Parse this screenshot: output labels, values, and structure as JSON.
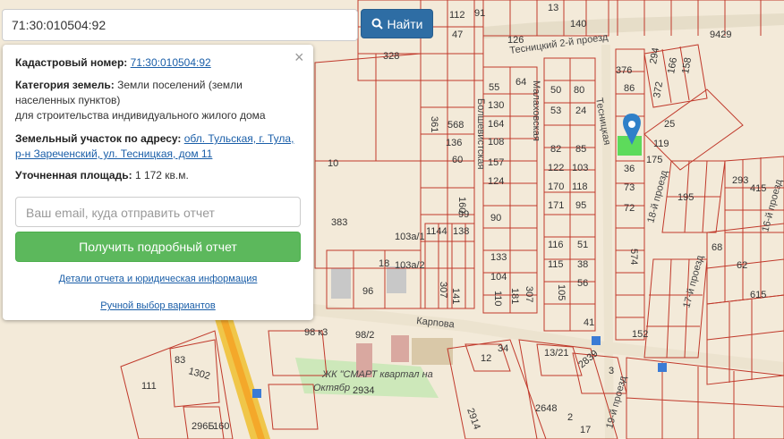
{
  "search": {
    "value": "71:30:010504:92",
    "button_label": "Найти"
  },
  "popup": {
    "cadastral_label": "Кадастровый номер:",
    "cadastral_value": "71:30:010504:92",
    "category_label": "Категория земель:",
    "category_value_1": "Земли поселений (земли",
    "category_value_2": "населенных пунктов)",
    "category_value_3": "для строительства индивидуального жилого дома",
    "address_label": "Земельный участок по адресу:",
    "address_line_1": "обл. Тульская, г. Тула,",
    "address_line_2": "р-н Зареченский, ул. Тесницкая, дом 11",
    "area_label": "Уточненная площадь:",
    "area_value": "1 172 кв.м.",
    "email_placeholder": "Ваш email, куда отправить отчет",
    "report_button": "Получить подробный отчет",
    "details_link": "Детали отчета и юридическая информация",
    "manual_link": "Ручной выбор вариантов",
    "close_symbol": "×"
  },
  "map": {
    "streets": {
      "tesnitsky_2": "Тесницкий 2-й проезд",
      "malakhovskaya": "Малаховская",
      "bolshevistskaya": "Болшевистская",
      "tesnitskaya": "Тесницкая",
      "karpova": "Карпова",
      "proezd_18": "18-й проезд",
      "proezd_17": "17-й проезд",
      "proezd_16": "16-й проезд",
      "proezd_19": "19-й проезд"
    },
    "smart_label_1": "ЖК \"СМАРТ квартал на",
    "smart_label_2": "Октябр",
    "parcel_labels": {
      "n112": "112",
      "n13": "13",
      "n140": "140",
      "n47": "47",
      "n91": "91",
      "n126": "126",
      "n328": "328",
      "n361": "361",
      "n568": "568",
      "n136": "136",
      "n60": "60",
      "n10": "10",
      "n160": "160",
      "n99": "99",
      "n55": "55",
      "n64": "64",
      "n130": "130",
      "n164": "164",
      "n108": "108",
      "n157": "157",
      "n124": "124",
      "n90": "90",
      "n133": "133",
      "n104": "104",
      "n110": "110",
      "n50": "50",
      "n53": "53",
      "n82": "82",
      "n122": "122",
      "n170": "170",
      "n171": "171",
      "n116": "116",
      "n115": "115",
      "n105": "105",
      "n80": "80",
      "n24": "24",
      "n85": "85",
      "n103": "103",
      "n118": "118",
      "n95": "95",
      "n51": "51",
      "n38": "38",
      "n56": "56",
      "n41": "41",
      "n376": "376",
      "n86": "86",
      "n36": "36",
      "n73": "73",
      "n72": "72",
      "n574": "574",
      "n152": "152",
      "n119": "119",
      "n175": "175",
      "n195": "195",
      "n293": "293",
      "n415": "415",
      "n9429": "9429",
      "n294": "294",
      "n166": "166",
      "n158": "158",
      "n372": "372",
      "n25": "25",
      "n1144": "1144",
      "n138": "138",
      "n18": "18",
      "n96": "96",
      "n383": "383",
      "n103a1": "103а/1",
      "n103a2": "103а/2",
      "n98k3": "98 к3",
      "n982": "98/2",
      "n83": "83",
      "n1302": "1302",
      "n111": "111",
      "n160b": "160",
      "n2648": "2648",
      "n2914": "2914",
      "n2934": "2934",
      "n1321": "13/21",
      "n2839": "2839",
      "n12": "12",
      "n3": "3",
      "n2": "2",
      "n34": "34",
      "n17": "17",
      "n141": "141",
      "n307": "307",
      "n181": "181",
      "n307b": "307",
      "n2965": "296Б",
      "n68": "68",
      "n62": "62",
      "n615": "615"
    }
  }
}
